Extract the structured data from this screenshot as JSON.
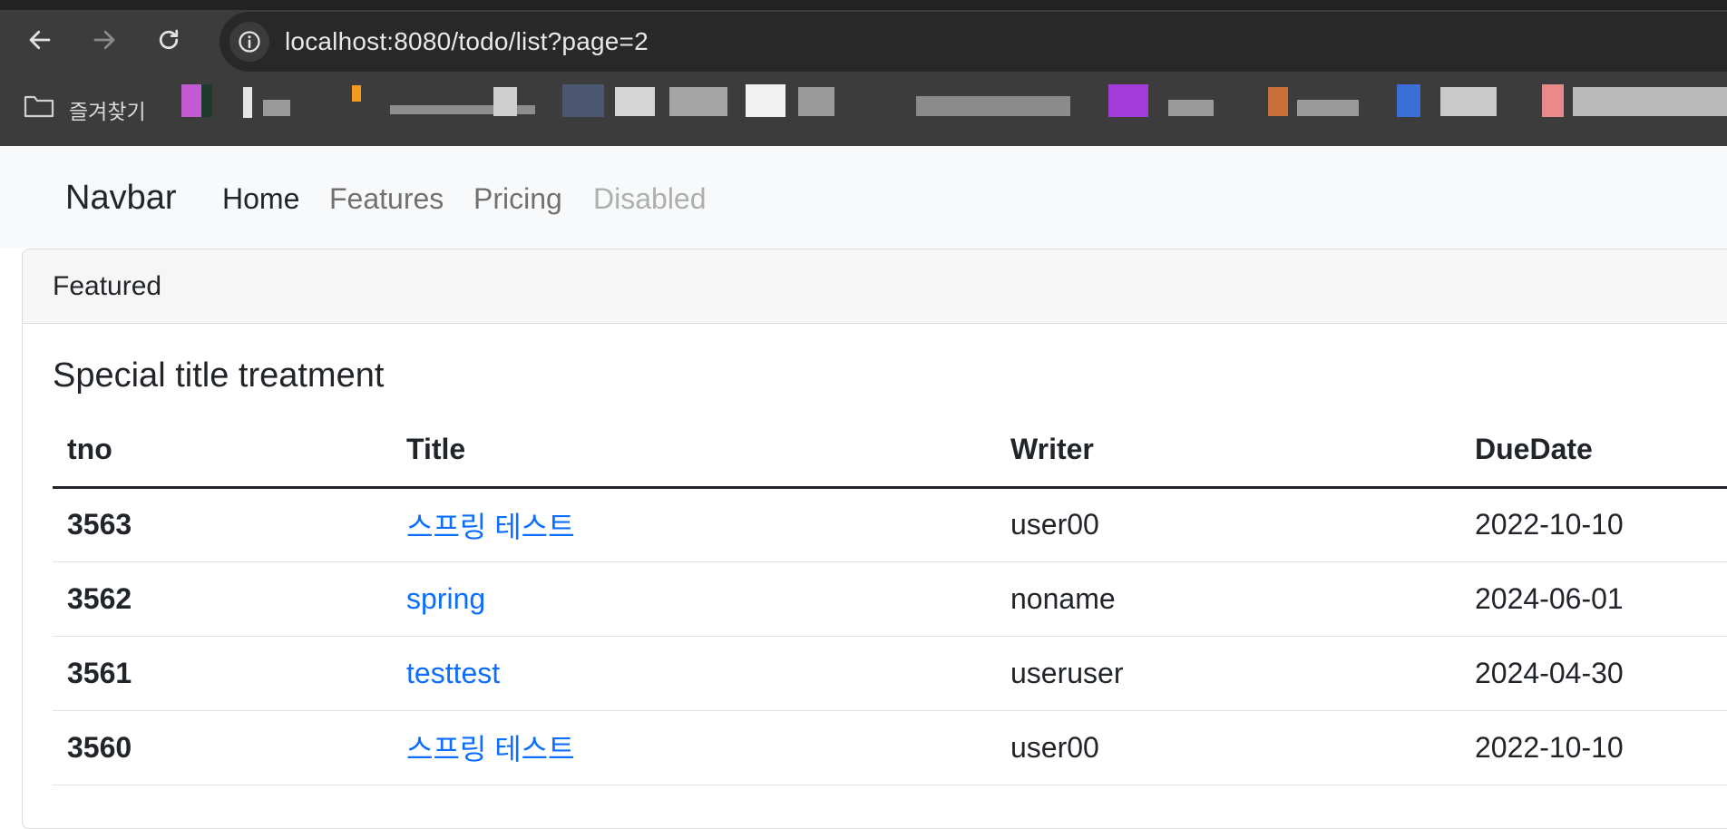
{
  "browser": {
    "url": "localhost:8080/todo/list?page=2",
    "bookmarks_label": "즐겨찾기",
    "back_icon": "arrow-left-icon",
    "forward_icon": "arrow-right-icon",
    "reload_icon": "reload-icon",
    "info_icon": "info-icon"
  },
  "navbar": {
    "brand": "Navbar",
    "links": [
      {
        "label": "Home",
        "state": "active"
      },
      {
        "label": "Features",
        "state": "normal"
      },
      {
        "label": "Pricing",
        "state": "normal"
      },
      {
        "label": "Disabled",
        "state": "disabled"
      }
    ]
  },
  "card": {
    "header": "Featured",
    "title": "Special title treatment",
    "table": {
      "columns": [
        "tno",
        "Title",
        "Writer",
        "DueDate"
      ],
      "rows": [
        {
          "tno": "3563",
          "title": "스프링 테스트",
          "writer": "user00",
          "dueDate": "2022-10-10"
        },
        {
          "tno": "3562",
          "title": "spring",
          "writer": "noname",
          "dueDate": "2024-06-01"
        },
        {
          "tno": "3561",
          "title": "testtest",
          "writer": "useruser",
          "dueDate": "2024-04-30"
        },
        {
          "tno": "3560",
          "title": "스프링 테스트",
          "writer": "user00",
          "dueDate": "2022-10-10"
        }
      ]
    }
  },
  "colors": {
    "chrome_bg": "#3c3c3c",
    "omnibox_bg": "#282828",
    "navbar_bg": "#f8f9fa",
    "link": "#0d6efd",
    "text": "#212529"
  }
}
